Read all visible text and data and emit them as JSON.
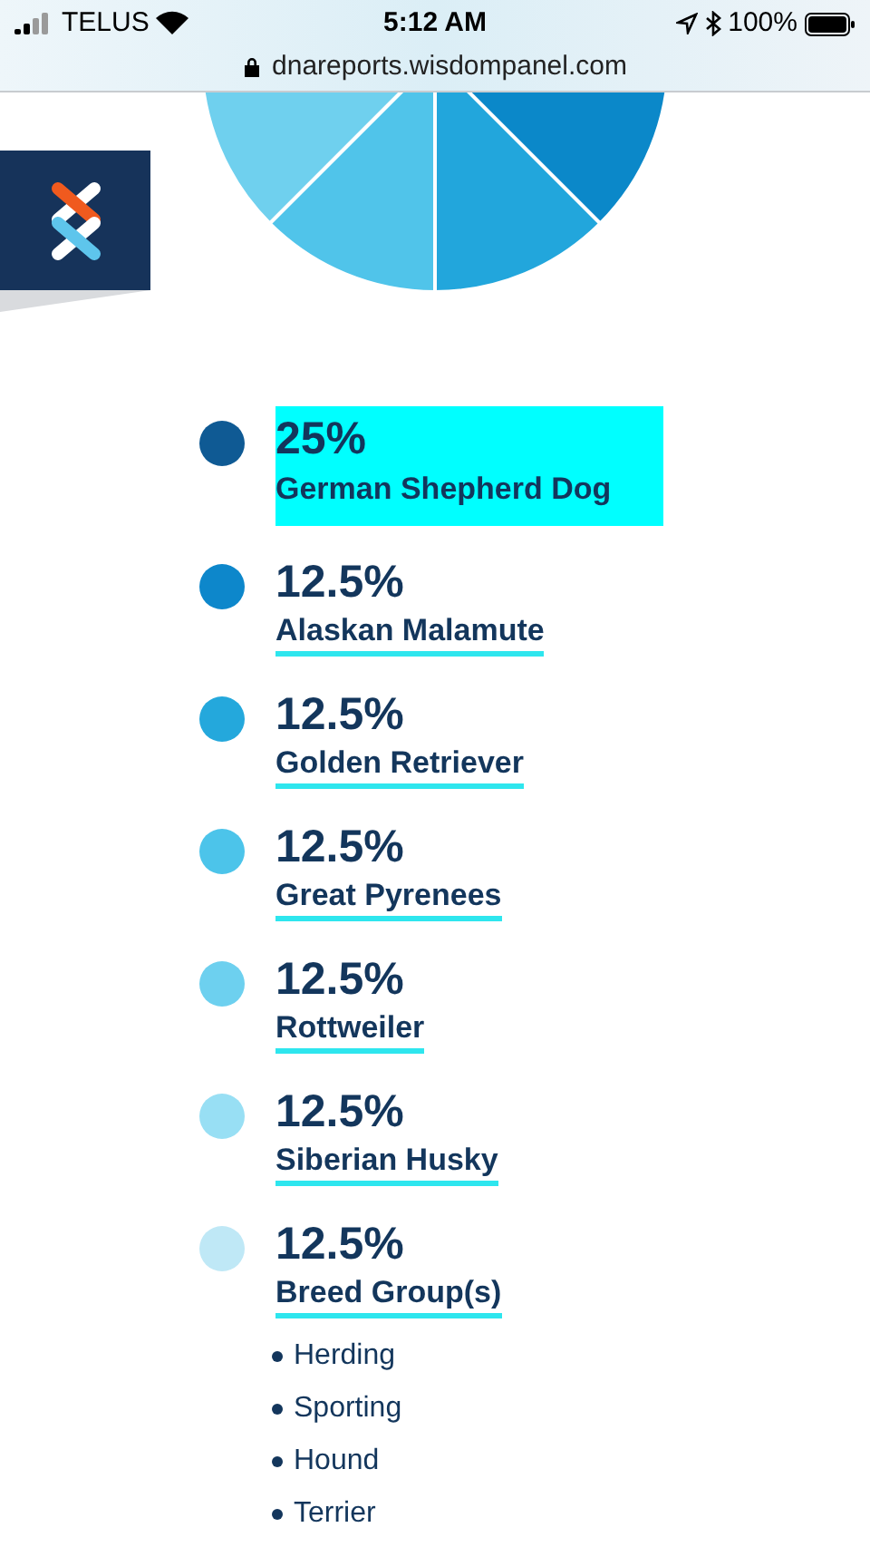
{
  "status_bar": {
    "carrier": "TELUS",
    "time": "5:12 AM",
    "battery": "100%"
  },
  "address_bar": {
    "url": "dnareports.wisdompanel.com"
  },
  "breeds": [
    {
      "percent": "25%",
      "name": "German Shepherd Dog",
      "color": "#0f5a94",
      "selected": true
    },
    {
      "percent": "12.5%",
      "name": "Alaskan Malamute",
      "color": "#0d87cb",
      "selected": false
    },
    {
      "percent": "12.5%",
      "name": "Golden Retriever",
      "color": "#24a8dc",
      "selected": false
    },
    {
      "percent": "12.5%",
      "name": "Great Pyrenees",
      "color": "#4cc4ea",
      "selected": false
    },
    {
      "percent": "12.5%",
      "name": "Rottweiler",
      "color": "#6dd0ef",
      "selected": false
    },
    {
      "percent": "12.5%",
      "name": "Siberian Husky",
      "color": "#98dff4",
      "selected": false
    },
    {
      "percent": "12.5%",
      "name": "Breed Group(s)",
      "color": "#bfe8f6",
      "selected": false,
      "children": [
        {
          "name": "Herding"
        },
        {
          "name": "Sporting"
        },
        {
          "name": "Hound"
        },
        {
          "name": "Terrier"
        }
      ]
    }
  ]
}
